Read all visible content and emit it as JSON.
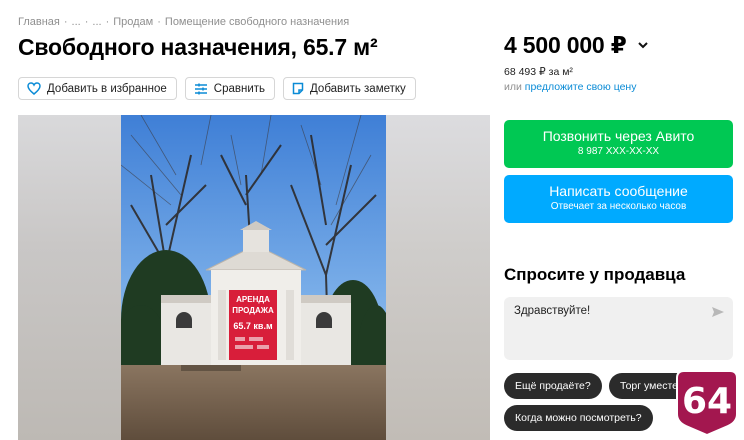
{
  "breadcrumb": {
    "items": [
      "Главная",
      "...",
      "...",
      "Продам",
      "Помещение свободного назначения"
    ]
  },
  "listing": {
    "title": "Свободного назначения, 65.7 м²",
    "price": "4 500 000 ₽",
    "price_per_m2": "68 493 ₽ за м²",
    "offer_prefix": "или",
    "offer_link": "предложите свою цену"
  },
  "actions": {
    "favorite": "Добавить в избранное",
    "compare": "Сравнить",
    "note": "Добавить заметку"
  },
  "photo": {
    "sign_line1": "АРЕНДА",
    "sign_line2": "ПРОДАЖА",
    "sign_line3": "65.7 кв.м"
  },
  "contact": {
    "call_label": "Позвонить через Авито",
    "call_phone": "8 987 XXX-XX-XX",
    "message_label": "Написать сообщение",
    "message_sub": "Отвечает за несколько часов"
  },
  "ask": {
    "title": "Спросите у продавца",
    "input_value": "Здравствуйте!",
    "chips": [
      "Ещё продаёте?",
      "Торг уместен?",
      "Когда можно посмотреть?"
    ]
  },
  "watermark": {
    "text": "64",
    "color": "#a3174f"
  },
  "colors": {
    "call": "#00c853",
    "message": "#00aaff",
    "link": "#0a8bd6"
  },
  "icons": {
    "favorite": "heart-icon",
    "compare": "compare-icon",
    "note": "note-icon",
    "price_menu": "chevron-down-icon",
    "send": "send-icon"
  }
}
